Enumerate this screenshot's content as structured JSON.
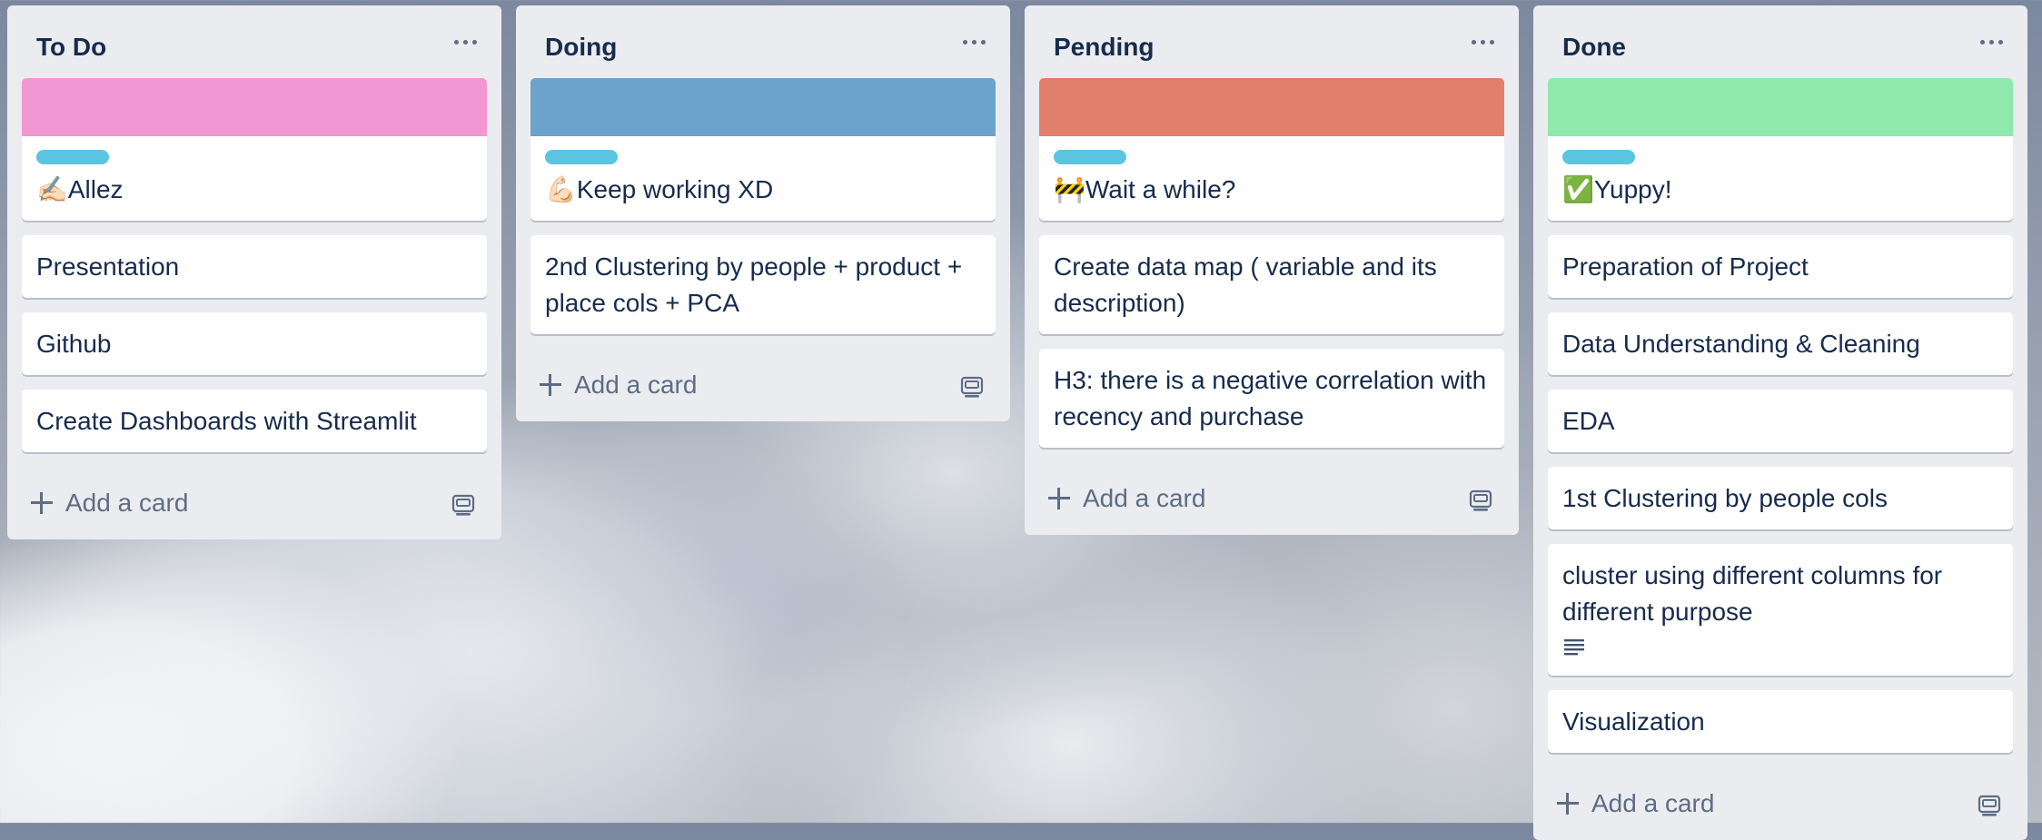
{
  "lists": [
    {
      "title": "To Do",
      "cover_color": "#f197d3",
      "cards": [
        {
          "title": "✍🏻Allez",
          "has_label": true
        },
        {
          "title": "Presentation"
        },
        {
          "title": "Github"
        },
        {
          "title": "Create Dashboards with Streamlit"
        }
      ],
      "add_card": "Add a card"
    },
    {
      "title": "Doing",
      "cover_color": "#6ca3cc",
      "cards": [
        {
          "title": "💪🏻Keep working XD",
          "has_label": true
        },
        {
          "title": "2nd Clustering by people + product + place cols + PCA"
        }
      ],
      "add_card": "Add a card"
    },
    {
      "title": "Pending",
      "cover_color": "#e27f6b",
      "cards": [
        {
          "title": "🚧Wait a while?",
          "has_label": true
        },
        {
          "title": "Create data map ( variable and its description)"
        },
        {
          "title": "H3: there is a negative correlation with recency and purchase"
        }
      ],
      "add_card": "Add a card"
    },
    {
      "title": "Done",
      "cover_color": "#8fe9ad",
      "cards": [
        {
          "title": "✅Yuppy!",
          "has_label": true
        },
        {
          "title": "Preparation of Project"
        },
        {
          "title": "Data Understanding & Cleaning"
        },
        {
          "title": "EDA"
        },
        {
          "title": "1st Clustering by people cols"
        },
        {
          "title": "cluster using different columns for different purpose",
          "has_description": true
        },
        {
          "title": "Visualization"
        }
      ],
      "add_card": "Add a card"
    }
  ],
  "colors": {
    "list_bg": "#ebecf0",
    "label": "#5bc4e0",
    "text": "#172b4d",
    "muted": "#5e6c84"
  },
  "icons": {
    "list_menu": "more-horizontal-icon",
    "add": "plus-icon",
    "template": "card-template-icon",
    "description": "description-lines-icon"
  }
}
